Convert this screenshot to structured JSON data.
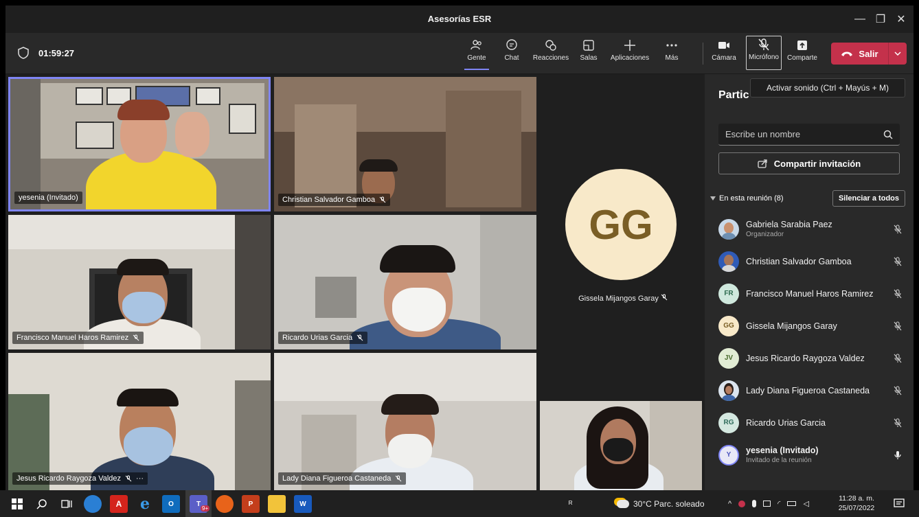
{
  "window": {
    "title": "Asesorías ESR"
  },
  "toolbar": {
    "timer": "01:59:27",
    "buttons": {
      "people": "Gente",
      "chat": "Chat",
      "reactions": "Reacciones",
      "rooms": "Salas",
      "apps": "Aplicaciones",
      "more": "Más",
      "camera": "Cámara",
      "mic": "Micrófono",
      "share": "Comparte"
    },
    "leave": "Salir"
  },
  "tooltip": {
    "text": "Activar sonido (Ctrl + Mayús + M)"
  },
  "tiles": [
    {
      "name": "yesenia (Invitado)"
    },
    {
      "name": "Christian Salvador Gamboa"
    },
    {
      "name": "Francisco Manuel Haros Ramirez"
    },
    {
      "name": "Ricardo Urias Garcia"
    },
    {
      "name": "Jesus Ricardo Raygoza Valdez",
      "more": "···"
    },
    {
      "name": "Lady Diana Figueroa Castaneda"
    }
  ],
  "featured": {
    "initials": "GG",
    "name": "Gissela Mijangos Garay"
  },
  "panel": {
    "title": "Partic",
    "search_placeholder": "Escribe un nombre",
    "invite": "Compartir invitación",
    "section": "En esta reunión (8)",
    "mute_all": "Silenciar a todos",
    "participants": [
      {
        "name": "Gabriela Sarabia Paez",
        "role": "Organizador",
        "initials": ""
      },
      {
        "name": "Christian Salvador Gamboa",
        "role": "",
        "initials": ""
      },
      {
        "name": "Francisco Manuel Haros Ramirez",
        "role": "",
        "initials": "FR"
      },
      {
        "name": "Gissela Mijangos Garay",
        "role": "",
        "initials": "GG"
      },
      {
        "name": "Jesus Ricardo Raygoza Valdez",
        "role": "",
        "initials": "JV"
      },
      {
        "name": "Lady Diana Figueroa Castaneda",
        "role": "",
        "initials": ""
      },
      {
        "name": "Ricardo Urias Garcia",
        "role": "",
        "initials": "RG"
      },
      {
        "name": "yesenia (Invitado)",
        "role": "Invitado de la reunión",
        "initials": "Y"
      }
    ]
  },
  "taskbar": {
    "teams_badge": "9+",
    "weather": "30°C  Parc. soleado",
    "time": "11:28 a. m.",
    "date": "25/07/2022"
  },
  "colors": {
    "accent": "#7f85f5",
    "leave": "#c4314b",
    "active_tile_border": "#7f85f5"
  }
}
